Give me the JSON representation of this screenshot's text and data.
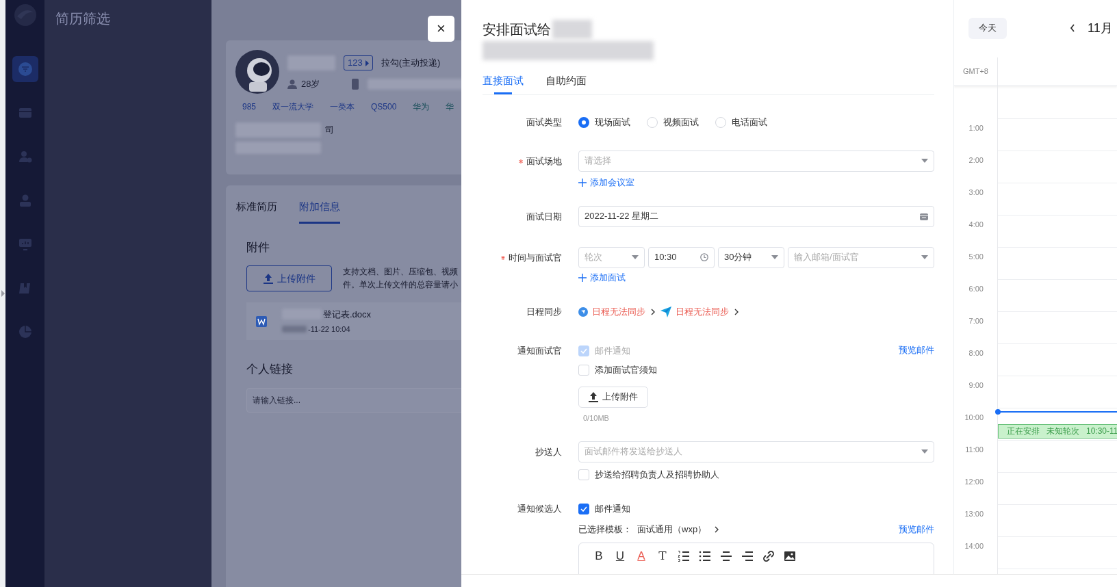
{
  "sidebar": {
    "items": [
      {
        "kind": "filter",
        "selected": true
      },
      {
        "kind": "tray",
        "selected": false
      },
      {
        "kind": "user-gear",
        "selected": false
      },
      {
        "kind": "user",
        "selected": false
      },
      {
        "kind": "monitor",
        "selected": false
      },
      {
        "kind": "book",
        "selected": false
      },
      {
        "kind": "pie",
        "selected": false
      }
    ]
  },
  "page_title": "简历筛选",
  "candidate": {
    "badge": "123",
    "source": "拉勾(主动投递)",
    "age": "28岁",
    "tags": [
      {
        "label": "985",
        "color": "#1b3585"
      },
      {
        "label": "双一流大学",
        "color": "#1b3585"
      },
      {
        "label": "一类本",
        "color": "#1b3585"
      },
      {
        "label": "QS500",
        "color": "#1b3585"
      },
      {
        "label": "华为",
        "color": "#124a55"
      },
      {
        "label": "华",
        "color": "#124a55"
      }
    ],
    "company_fragment": "司"
  },
  "resume_tabs": [
    {
      "label": "标准简历",
      "selected": false
    },
    {
      "label": "附加信息",
      "selected": true
    }
  ],
  "attachments": {
    "heading": "附件",
    "upload_button": "上传附件",
    "hint_lines": [
      "支持文档、图片、压缩包、视频",
      "件。单次上传文件的总容量请小"
    ],
    "file": {
      "name": "登记表.docx",
      "time": "-11-22 10:04"
    }
  },
  "links": {
    "heading": "个人链接",
    "placeholder": "请输入链接..."
  },
  "close_button": "×",
  "drawer": {
    "title": "安排面试给",
    "tabs": [
      {
        "label": "直接面试",
        "selected": true
      },
      {
        "label": "自助约面",
        "selected": false
      }
    ],
    "interview_type": {
      "label": "面试类型",
      "required": false,
      "options": [
        {
          "label": "现场面试",
          "selected": true
        },
        {
          "label": "视频面试",
          "selected": false
        },
        {
          "label": "电话面试",
          "selected": false
        }
      ]
    },
    "venue": {
      "label": "面试场地",
      "required": true,
      "placeholder": "请选择",
      "add_link": "添加会议室"
    },
    "date": {
      "label": "面试日期",
      "required": false,
      "value": "2022-11-22 星期二"
    },
    "time_interviewer": {
      "label": "时间与面试官",
      "required": true,
      "round_placeholder": "轮次",
      "time": "10:30",
      "duration": "30分钟",
      "interviewer_placeholder": "输入邮箱/面试官",
      "add_link": "添加面试"
    },
    "calendar_sync": {
      "label": "日程同步",
      "required": false,
      "items": [
        {
          "kind": "compass",
          "text": "日程无法同步"
        },
        {
          "kind": "plane",
          "text": "日程无法同步"
        }
      ]
    },
    "notify_interviewer": {
      "label": "通知面试官",
      "required": false,
      "email": {
        "label": "邮件通知",
        "checked": true,
        "disabled": true
      },
      "preview_link": "预览邮件",
      "notice": {
        "label": "添加面试官须知",
        "checked": false
      },
      "upload_button": "上传附件",
      "quota": "0/10MB"
    },
    "cc": {
      "label": "抄送人",
      "required": false,
      "placeholder": "面试邮件将发送给抄送人",
      "option": {
        "label": "抄送给招聘负责人及招聘协助人",
        "checked": false
      }
    },
    "notify_candidate": {
      "label": "通知候选人",
      "required": false,
      "email": {
        "label": "邮件通知",
        "checked": true,
        "disabled": false
      },
      "template_label": "已选择模板：",
      "template": "面试通用（wxp）",
      "preview_link": "预览邮件",
      "toolbar": [
        {
          "kind": "bold",
          "glyph": "B"
        },
        {
          "kind": "underline",
          "glyph": "U"
        },
        {
          "kind": "color",
          "glyph": "A"
        },
        {
          "kind": "size",
          "glyph": "T"
        },
        {
          "kind": "ordered-list"
        },
        {
          "kind": "bullet-list"
        },
        {
          "kind": "align-center"
        },
        {
          "kind": "align-right"
        },
        {
          "kind": "link"
        },
        {
          "kind": "image"
        }
      ]
    }
  },
  "calendar": {
    "today_button": "今天",
    "month": "11月",
    "timezone": "GMT+8",
    "hours": [
      {
        "label": "1:00",
        "now_line": false
      },
      {
        "label": "2:00",
        "now_line": false
      },
      {
        "label": "3:00",
        "now_line": false
      },
      {
        "label": "4:00",
        "now_line": false
      },
      {
        "label": "5:00",
        "now_line": false
      },
      {
        "label": "6:00",
        "now_line": false
      },
      {
        "label": "7:00",
        "now_line": false
      },
      {
        "label": "8:00",
        "now_line": false
      },
      {
        "label": "9:00",
        "now_line": false
      },
      {
        "label": "10:00",
        "now_line": true,
        "event": {
          "status": "正在安排",
          "round": "未知轮次",
          "time": "10:30-11"
        }
      },
      {
        "label": "11:00",
        "now_line": false
      },
      {
        "label": "12:00",
        "now_line": false
      },
      {
        "label": "13:00",
        "now_line": false
      },
      {
        "label": "14:00",
        "now_line": false
      }
    ]
  }
}
